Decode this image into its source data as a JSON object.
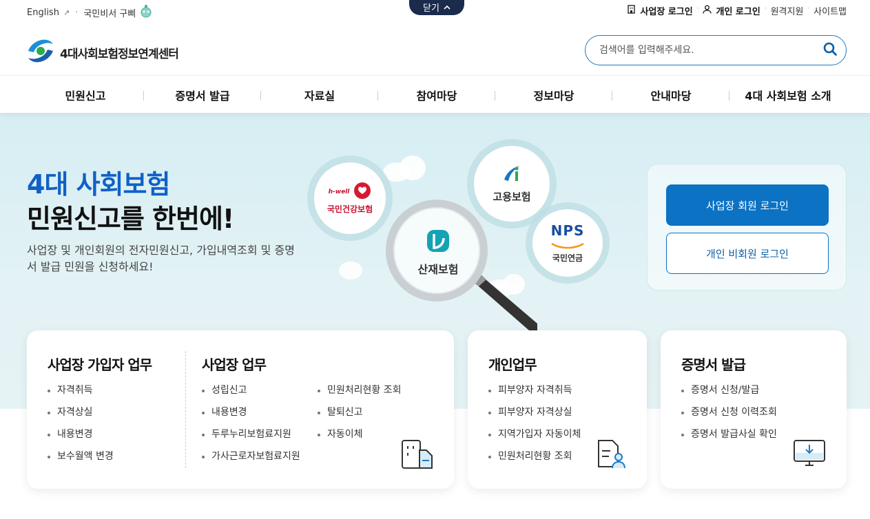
{
  "topbar": {
    "english": "English",
    "guide": "국민비서 구삐",
    "close": "닫기",
    "biz_login": "사업장 로그인",
    "ind_login": "개인 로그인",
    "remote": "원격지원",
    "sitemap": "사이트맵"
  },
  "header": {
    "logo_text": "4대사회보험정보연계센터",
    "search_placeholder": "검색어를 입력해주세요."
  },
  "gnb": [
    "민원신고",
    "증명서 발급",
    "자료실",
    "참여마당",
    "정보마당",
    "안내마당",
    "4대 사회보험 소개"
  ],
  "hero": {
    "title1": "4대 사회보험",
    "title2": "민원신고를 한번에!",
    "desc": "사업장 및 개인회원의 전자민원신고, 가입내역조회 및 증명서 발급 민원을 신청하세요!",
    "circles": {
      "health_brand": "h-well",
      "health": "국민건강보험",
      "employ": "고용보험",
      "accident": "산재보험",
      "nps_brand": "NPS",
      "pension": "국민연금"
    }
  },
  "login": {
    "biz": "사업장 회원 로그인",
    "ind": "개인 비회원 로그인"
  },
  "cards": {
    "join": {
      "title": "사업장 가입자 업무",
      "items": [
        "자격취득",
        "자격상실",
        "내용변경",
        "보수월액 변경"
      ]
    },
    "biz": {
      "title": "사업장 업무",
      "col1": [
        "성립신고",
        "내용변경",
        "두루누리보험료지원",
        "가사근로자보험료지원"
      ],
      "col2": [
        "민원처리현황 조회",
        "탈퇴신고",
        "자동이체"
      ]
    },
    "personal": {
      "title": "개인업무",
      "items": [
        "피부양자 자격취득",
        "피부양자 자격상실",
        "지역가입자 자동이체",
        "민원처리현황 조회"
      ]
    },
    "cert": {
      "title": "증명서 발급",
      "items": [
        "증명서 신청/발급",
        "증명서 신청 이력조회",
        "증명서 발급사실 확인"
      ]
    }
  },
  "colors": {
    "brand_blue": "#0b72c4",
    "title_blue": "#1060c8",
    "nav_dark": "#1b2b4b"
  }
}
